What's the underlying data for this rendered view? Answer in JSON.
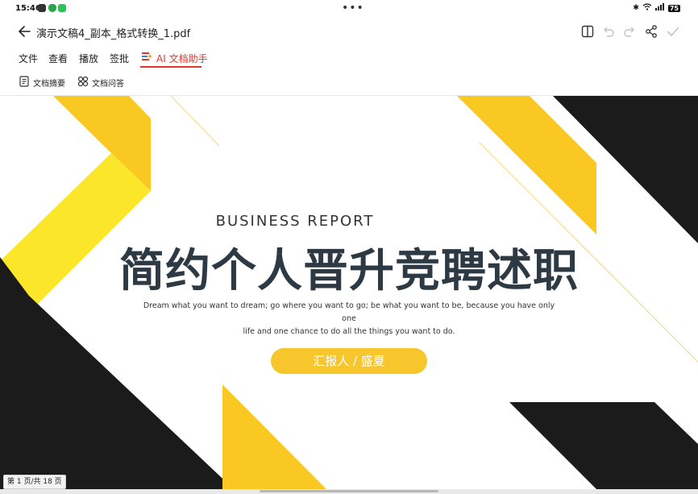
{
  "status": {
    "time": "15:46",
    "battery": "75"
  },
  "header": {
    "title": "演示文稿4_副本_格式转换_1.pdf"
  },
  "menu": {
    "items": [
      "文件",
      "查看",
      "播放",
      "签批"
    ],
    "ai_label": "AI 文档助手"
  },
  "subbar": {
    "summary": "文档摘要",
    "qa": "文档问答"
  },
  "slide": {
    "business": "BUSINESS REPORT",
    "title": "简约个人晋升竞聘述职",
    "desc_line1": "Dream what you want to dream; go where you want to go; be what you want to be, because you have only one",
    "desc_line2": "life and one chance to do all the things you want to do.",
    "presenter": "汇报人 / 盛夏"
  },
  "page_indicator": "第 1 页/共 18 页",
  "colors": {
    "accent": "#e0382e",
    "yellow": "#f7c62d",
    "black": "#1b1b1b"
  }
}
